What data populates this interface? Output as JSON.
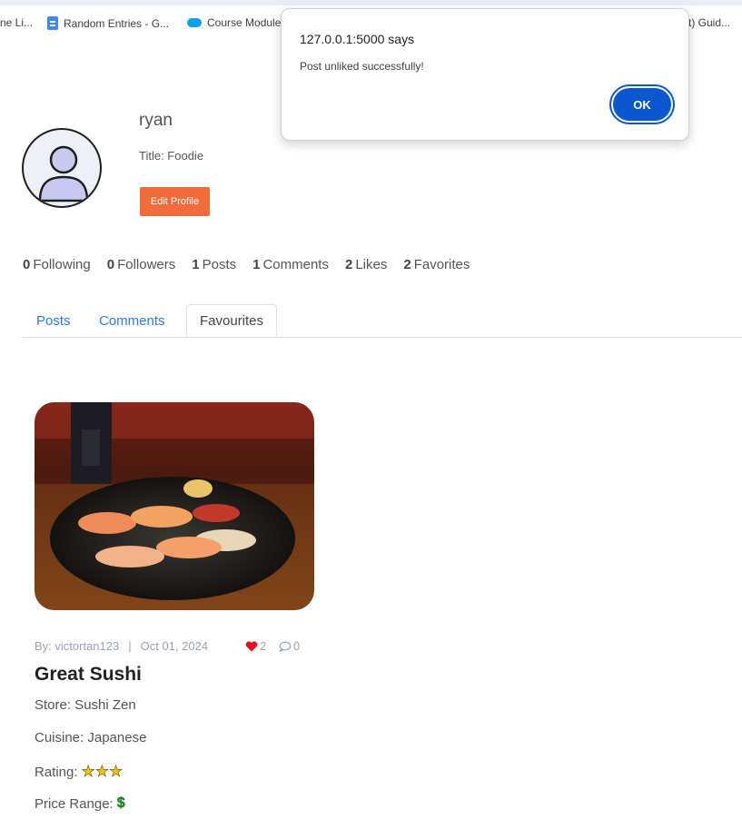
{
  "bookmarks": {
    "items": [
      {
        "label": "ne Li..."
      },
      {
        "label": "Random Entries - G..."
      },
      {
        "label": "Course Module"
      },
      {
        "label": "t) Guid..."
      }
    ]
  },
  "profile": {
    "username": "ryan",
    "title": "Title: Foodie",
    "edit_label": "Edit Profile"
  },
  "stats": [
    {
      "count": "0",
      "label": "Following"
    },
    {
      "count": "0",
      "label": "Followers"
    },
    {
      "count": "1",
      "label": "Posts"
    },
    {
      "count": "1",
      "label": "Comments"
    },
    {
      "count": "2",
      "label": "Likes"
    },
    {
      "count": "2",
      "label": "Favorites"
    }
  ],
  "tabs": [
    {
      "label": "Posts"
    },
    {
      "label": "Comments"
    },
    {
      "label": "Favourites",
      "active": true
    }
  ],
  "post": {
    "author": "By: victortan123",
    "separator": "|",
    "date": "Oct 01, 2024",
    "likes": "2",
    "comments": "0",
    "title": "Great Sushi",
    "store": "Store: Sushi Zen",
    "cuisine": "Cuisine: Japanese",
    "rating_label": "Rating:",
    "rating_stars": 3,
    "price_label": "Price Range:",
    "price_level": 1
  },
  "dialog": {
    "title": "127.0.0.1:5000 says",
    "message": "Post unliked successfully!",
    "ok_label": "OK"
  },
  "colors": {
    "accent_orange": "#f26b3a",
    "tab_link": "#2f7bd8",
    "ok_button": "#0b57d0",
    "heart": "#e0141e"
  }
}
